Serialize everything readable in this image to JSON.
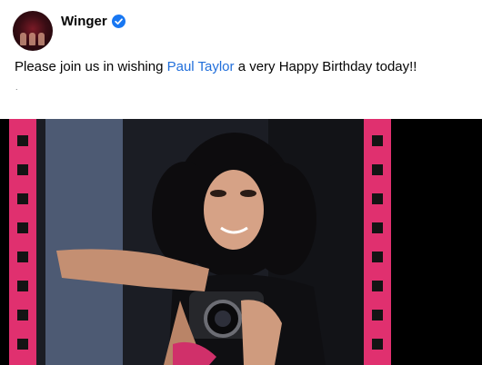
{
  "post": {
    "author": "Winger",
    "verified_icon": "verified-badge-icon",
    "text_before": "Please join us in wishing ",
    "mention": "Paul Taylor",
    "text_after": " a very Happy Birthday today!!",
    "extra_line": "."
  },
  "colors": {
    "link": "#216fdb",
    "verified": "#1877f2",
    "film_strip": "#e0306f"
  }
}
